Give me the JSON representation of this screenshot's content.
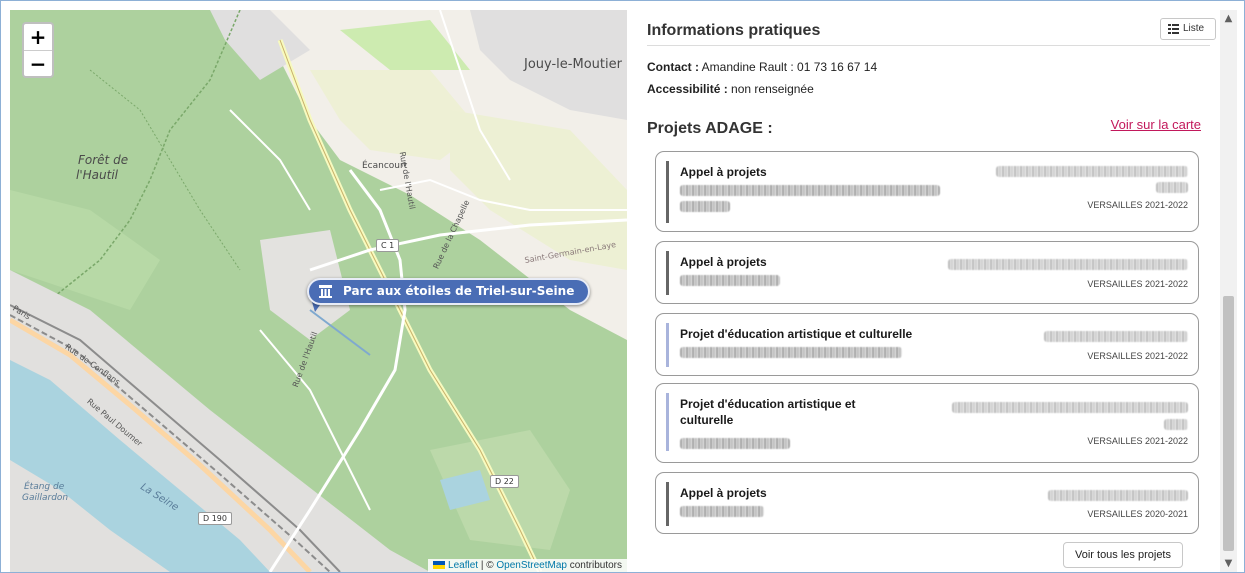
{
  "map": {
    "zoom_in_label": "+",
    "zoom_out_label": "−",
    "place_labels": {
      "jouy": "Jouy-le-Moutier",
      "foret_1": "Forêt de",
      "foret_2": "l'Hautil",
      "ecancourt": "Écancourt",
      "saint_germain": "Saint-Germain-en-Laye",
      "etang_1": "Étang de",
      "etang_2": "Gaillardon",
      "seine": "La Seine"
    },
    "road_labels": {
      "c1": "C 1",
      "d22": "D 22",
      "d190": "D 190",
      "rue_paul_doumer": "Rue Paul Doumer",
      "rue_hautil_1": "Rue de l'Hautil",
      "rue_hautil_2": "Rue de l'Hautil",
      "rue_chapelle": "Rue de la Chapelle",
      "rue_conflans": "Rue de Conflans",
      "paris_road": "Paris"
    },
    "marker_label": "Parc aux étoiles de Triel-sur-Seine",
    "attribution": {
      "leaflet": "Leaflet",
      "separator": " | © ",
      "osm": "OpenStreetMap",
      "contributors": " contributors"
    }
  },
  "panel": {
    "info_heading": "Informations pratiques",
    "liste_button": "Liste",
    "contact_label": "Contact :",
    "contact_value": " Amandine Rault : 01 73 16 67 14",
    "access_label": "Accessibilité :",
    "access_value": " non renseignée",
    "projects_heading": "Projets ADAGE :",
    "map_link": "Voir sur la carte",
    "projects": [
      {
        "title": "Appel à projets",
        "academy": "VERSAILLES 2021-2022",
        "type": "appel"
      },
      {
        "title": "Appel à projets",
        "academy": "VERSAILLES 2021-2022",
        "type": "appel"
      },
      {
        "title": "Projet d'éducation artistique et culturelle",
        "academy": "VERSAILLES 2021-2022",
        "type": "peac"
      },
      {
        "title": "Projet d'éducation artistique et culturelle",
        "academy": "VERSAILLES 2021-2022",
        "type": "peac"
      },
      {
        "title": "Appel à projets",
        "academy": "VERSAILLES 2020-2021",
        "type": "appel"
      }
    ],
    "all_projects_button": "Voir tous les projets"
  },
  "colors": {
    "accent_link": "#c2185b",
    "marker_blue": "#4a6db5",
    "appel_bar": "#666666",
    "peac_bar": "#a9b4dc"
  }
}
